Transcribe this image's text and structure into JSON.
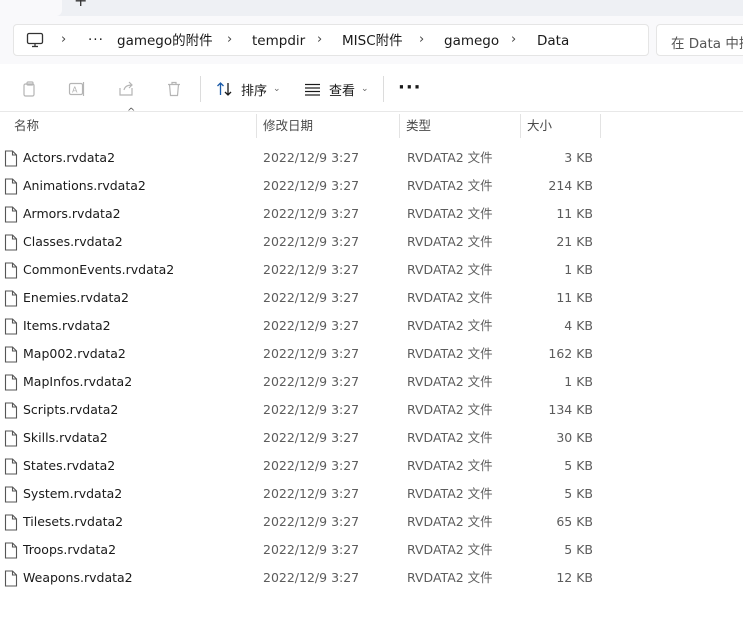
{
  "tabs": {
    "new_tab_glyph": "+"
  },
  "breadcrumb": {
    "icon": "monitor-icon",
    "overflow": "···",
    "segments": [
      "gamego的附件",
      "tempdir",
      "MISC附件",
      "gamego",
      "Data"
    ],
    "separator": "›"
  },
  "search": {
    "placeholder": "在 Data 中搜索"
  },
  "toolbar": {
    "icons": [
      "copy-icon",
      "rename-icon",
      "share-icon",
      "delete-icon"
    ],
    "sort_label": "排序",
    "view_label": "查看",
    "more": "···"
  },
  "columns": {
    "name": "名称",
    "date": "修改日期",
    "type": "类型",
    "size": "大小",
    "sort_indicator": "^"
  },
  "files": [
    {
      "name": "Actors.rvdata2",
      "date": "2022/12/9 3:27",
      "type": "RVDATA2 文件",
      "size": "3 KB"
    },
    {
      "name": "Animations.rvdata2",
      "date": "2022/12/9 3:27",
      "type": "RVDATA2 文件",
      "size": "214 KB"
    },
    {
      "name": "Armors.rvdata2",
      "date": "2022/12/9 3:27",
      "type": "RVDATA2 文件",
      "size": "11 KB"
    },
    {
      "name": "Classes.rvdata2",
      "date": "2022/12/9 3:27",
      "type": "RVDATA2 文件",
      "size": "21 KB"
    },
    {
      "name": "CommonEvents.rvdata2",
      "date": "2022/12/9 3:27",
      "type": "RVDATA2 文件",
      "size": "1 KB"
    },
    {
      "name": "Enemies.rvdata2",
      "date": "2022/12/9 3:27",
      "type": "RVDATA2 文件",
      "size": "11 KB"
    },
    {
      "name": "Items.rvdata2",
      "date": "2022/12/9 3:27",
      "type": "RVDATA2 文件",
      "size": "4 KB"
    },
    {
      "name": "Map002.rvdata2",
      "date": "2022/12/9 3:27",
      "type": "RVDATA2 文件",
      "size": "162 KB"
    },
    {
      "name": "MapInfos.rvdata2",
      "date": "2022/12/9 3:27",
      "type": "RVDATA2 文件",
      "size": "1 KB"
    },
    {
      "name": "Scripts.rvdata2",
      "date": "2022/12/9 3:27",
      "type": "RVDATA2 文件",
      "size": "134 KB"
    },
    {
      "name": "Skills.rvdata2",
      "date": "2022/12/9 3:27",
      "type": "RVDATA2 文件",
      "size": "30 KB"
    },
    {
      "name": "States.rvdata2",
      "date": "2022/12/9 3:27",
      "type": "RVDATA2 文件",
      "size": "5 KB"
    },
    {
      "name": "System.rvdata2",
      "date": "2022/12/9 3:27",
      "type": "RVDATA2 文件",
      "size": "5 KB"
    },
    {
      "name": "Tilesets.rvdata2",
      "date": "2022/12/9 3:27",
      "type": "RVDATA2 文件",
      "size": "65 KB"
    },
    {
      "name": "Troops.rvdata2",
      "date": "2022/12/9 3:27",
      "type": "RVDATA2 文件",
      "size": "5 KB"
    },
    {
      "name": "Weapons.rvdata2",
      "date": "2022/12/9 3:27",
      "type": "RVDATA2 文件",
      "size": "12 KB"
    }
  ],
  "colors": {
    "accent": "#005fb8",
    "text": "#1a1a1a",
    "muted": "#5c5c5c"
  }
}
